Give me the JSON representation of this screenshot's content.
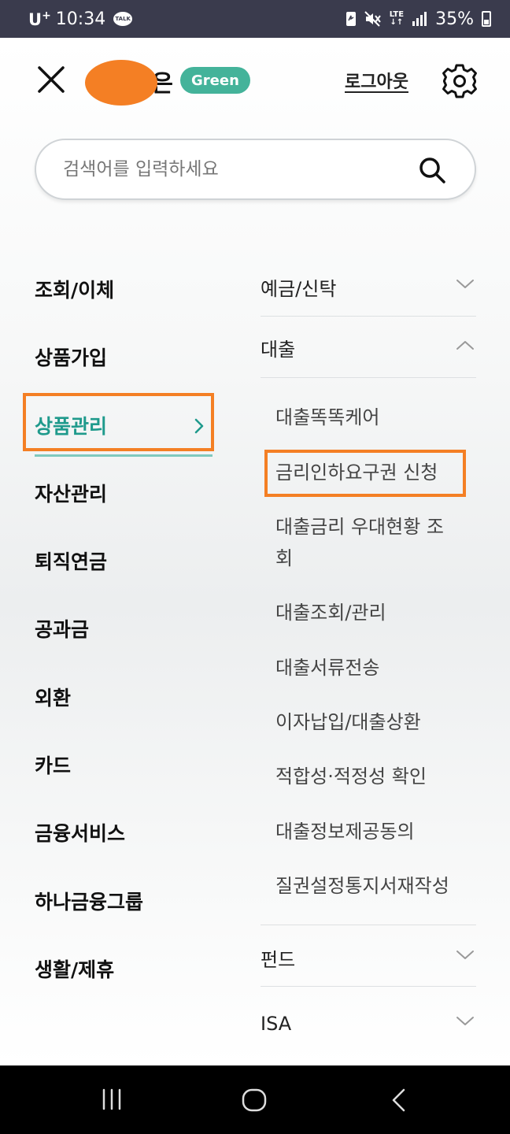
{
  "status_bar": {
    "carrier": "U",
    "carrier_sup": "+",
    "time": "10:34",
    "talk_badge": "TALK",
    "network": "LTE",
    "battery": "35%"
  },
  "header": {
    "user_suffix": "은",
    "grade": "Green",
    "logout_label": "로그아웃"
  },
  "search": {
    "placeholder": "검색어를 입력하세요"
  },
  "left_menu": {
    "items": [
      {
        "label": "조회/이체"
      },
      {
        "label": "상품가입"
      },
      {
        "label": "상품관리",
        "active": true
      },
      {
        "label": "자산관리"
      },
      {
        "label": "퇴직연금"
      },
      {
        "label": "공과금"
      },
      {
        "label": "외환"
      },
      {
        "label": "카드"
      },
      {
        "label": "금융서비스"
      },
      {
        "label": "하나금융그룹"
      },
      {
        "label": "생활/제휴"
      }
    ]
  },
  "right_menu": {
    "categories": [
      {
        "label": "예금/신탁",
        "expanded": false
      },
      {
        "label": "대출",
        "expanded": true
      },
      {
        "label": "펀드",
        "expanded": false
      },
      {
        "label": "ISA",
        "expanded": false
      }
    ],
    "loan_items": [
      {
        "label": "대출똑똑케어"
      },
      {
        "label": "금리인하요구권 신청",
        "highlighted": true
      },
      {
        "label": "대출금리 우대현황 조회"
      },
      {
        "label": "대출조회/관리"
      },
      {
        "label": "대출서류전송"
      },
      {
        "label": "이자납입/대출상환"
      },
      {
        "label": "적합성·적정성 확인"
      },
      {
        "label": "대출정보제공동의"
      },
      {
        "label": "질권설정통지서재작성"
      }
    ]
  },
  "colors": {
    "accent": "#1f9a8c",
    "badge": "#44b39a",
    "highlight": "#f47f24",
    "status_bar": "#3a3b4d",
    "nav_bar": "#000000"
  }
}
